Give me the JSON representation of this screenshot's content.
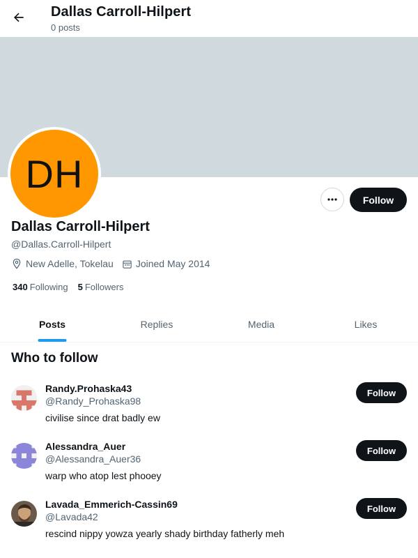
{
  "header": {
    "title": "Dallas Carroll-Hilpert",
    "posts_count": "0 posts"
  },
  "profile": {
    "avatar_initials": "DH",
    "avatar_color": "#ff9800",
    "banner_color": "#cfd9de",
    "name": "Dallas Carroll-Hilpert",
    "handle": "@Dallas.Carroll-Hilpert",
    "location": "New Adelle, Tokelau",
    "joined": "Joined May 2014",
    "following_count": "340",
    "following_label": "Following",
    "followers_count": "5",
    "followers_label": "Followers",
    "follow_label": "Follow"
  },
  "tabs": [
    {
      "label": "Posts",
      "active": true
    },
    {
      "label": "Replies",
      "active": false
    },
    {
      "label": "Media",
      "active": false
    },
    {
      "label": "Likes",
      "active": false
    }
  ],
  "who_to_follow": {
    "title": "Who to follow",
    "users": [
      {
        "name": "Randy.Prohaska43",
        "handle": "@Randy_Prohaska98",
        "bio": "civilise since drat badly ew",
        "follow_label": "Follow"
      },
      {
        "name": "Alessandra_Auer",
        "handle": "@Alessandra_Auer36",
        "bio": "warp who atop lest phooey",
        "follow_label": "Follow"
      },
      {
        "name": "Lavada_Emmerich-Cassin69",
        "handle": "@Lavada42",
        "bio": "rescind nippy yowza yearly shady birthday fatherly meh",
        "follow_label": "Follow"
      }
    ]
  },
  "colors": {
    "accent": "#1d9bf0",
    "button_dark": "#0f1419",
    "muted_text": "#536471"
  }
}
